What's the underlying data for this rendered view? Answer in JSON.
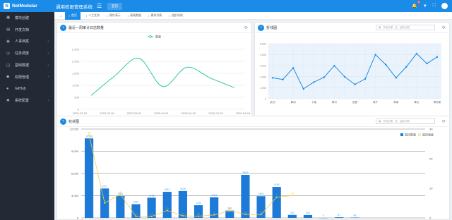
{
  "header": {
    "logo_text": "NetModular",
    "app_title": "通用权限管理系统",
    "home_tab": "首页",
    "notification_count": "3",
    "colors": {
      "primary": "#1b8be8",
      "sidebar_bg": "#232a35"
    }
  },
  "sidebar": {
    "items": [
      {
        "label": "模块创建",
        "icon": "module-icon",
        "has_children": false
      },
      {
        "label": "开发文档",
        "icon": "doc-icon",
        "has_children": false
      },
      {
        "label": "人事档案",
        "icon": "user-icon",
        "has_children": true
      },
      {
        "label": "任务调度",
        "icon": "task-icon",
        "has_children": true
      },
      {
        "label": "基础数据",
        "icon": "data-icon",
        "has_children": true
      },
      {
        "label": "权限管理",
        "icon": "lock-icon",
        "has_children": true
      },
      {
        "label": "GitHub",
        "icon": "github-icon",
        "has_children": false
      },
      {
        "label": "系统配置",
        "icon": "gear-icon",
        "has_children": true
      }
    ]
  },
  "tabs": [
    {
      "label": "首页",
      "active": true
    },
    {
      "label": "人工任务",
      "active": false
    },
    {
      "label": "操作演示",
      "active": false
    },
    {
      "label": "基础数据",
      "active": false
    },
    {
      "label": "模块列表",
      "active": false
    },
    {
      "label": "组织机构",
      "active": false
    }
  ],
  "date_range": {
    "start_placeholder": "开始日期",
    "sep": "至",
    "end_placeholder": "结束日期"
  },
  "cards": {
    "log": {
      "title": "最近一周审计日志数量"
    },
    "line": {
      "title": "折线图"
    },
    "bar": {
      "title": "柱状图"
    }
  },
  "chart_data": [
    {
      "type": "line",
      "smooth": true,
      "title": "最近一周审计日志数量",
      "series": [
        {
          "name": "数量",
          "values": [
            580,
            1400,
            2130,
            950,
            1750,
            1300,
            900
          ]
        }
      ],
      "categories": [
        "2020-03-29",
        "2020-03-30",
        "2020-03-31",
        "2020-04-01",
        "2020-04-02",
        "2020-04-03",
        "2020-04-04"
      ],
      "ylim": [
        0,
        2500
      ],
      "yticks": [
        "0",
        "500",
        "1,000",
        "1,500",
        "2,000",
        "2,500"
      ],
      "color": "#2ec7a6",
      "legend": "top-center",
      "grid": true
    },
    {
      "type": "line",
      "title": "折线图",
      "series": [
        {
          "values": [
            1900,
            1750,
            2800,
            900,
            1500,
            1950,
            3000,
            2000,
            1300,
            1800,
            4000,
            3100,
            1900,
            2900,
            4100,
            3200,
            3800
          ]
        }
      ],
      "categories": [
        "武汉",
        "",
        "黄冈",
        "",
        "十堰",
        "",
        "荆州",
        "",
        "宜昌",
        "",
        "咸宁",
        "",
        "孝感",
        "",
        "黄石",
        "",
        "神农架"
      ],
      "ylim": [
        0,
        5000
      ],
      "yticks": [
        "0",
        "1,000",
        "2,000",
        "3,000",
        "4,000",
        "5,000"
      ],
      "color": "#1b8be8",
      "area_fill": "#eaf3fb",
      "grid": true
    },
    {
      "type": "bar",
      "title": "柱状图",
      "categories": [
        "",
        "",
        "",
        "",
        "",
        "",
        "",
        "",
        "",
        "",
        "",
        "",
        "",
        "",
        "",
        "",
        "",
        "",
        "",
        "",
        "",
        ""
      ],
      "series": [
        {
          "name": "监控数量",
          "type": "bar",
          "values": [
            10738,
            3971,
            2960,
            1851,
            2725,
            3519,
            3626,
            1709,
            2784,
            990,
            5809,
            2929,
            4186,
            403,
            393,
            0,
            87,
            48
          ],
          "color": "#1e7ad7"
        },
        {
          "name": "监控速度",
          "type": "line",
          "values": [
            28,
            5,
            8,
            0.5,
            0.5,
            2.5,
            0.7,
            0.6,
            1,
            2.4,
            1.2,
            1.1,
            7,
            7.5
          ],
          "color": "#f4d03f"
        }
      ],
      "ylim": [
        0,
        12000
      ],
      "y2lim": [
        0,
        30
      ],
      "yticks": [
        "0",
        "3,000",
        "6,000",
        "9,000",
        "12,000"
      ],
      "y2ticks": [
        "0",
        "10",
        "20",
        "30"
      ],
      "legend": "top-right"
    }
  ]
}
